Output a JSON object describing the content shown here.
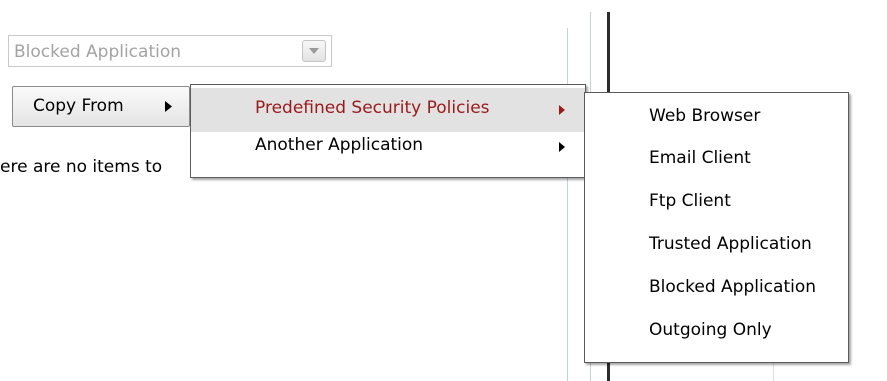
{
  "application_select": {
    "value": "Blocked Application"
  },
  "copy_from_button": {
    "label": "Copy From"
  },
  "empty_message": "ere are no items to",
  "copy_from_menu": {
    "items": [
      {
        "label": "Predefined Security Policies",
        "highlighted": true
      },
      {
        "label": "Another Application",
        "highlighted": false
      }
    ]
  },
  "predefined_policies_menu": {
    "items": [
      {
        "label": "Web Browser"
      },
      {
        "label": "Email Client"
      },
      {
        "label": "Ftp Client"
      },
      {
        "label": "Trusted Application"
      },
      {
        "label": "Blocked Application"
      },
      {
        "label": "Outgoing Only"
      }
    ]
  },
  "colors": {
    "highlight_text": "#9a1a1a",
    "highlight_bg": "#e2e2e2",
    "disabled_text": "#a3a3a3"
  }
}
